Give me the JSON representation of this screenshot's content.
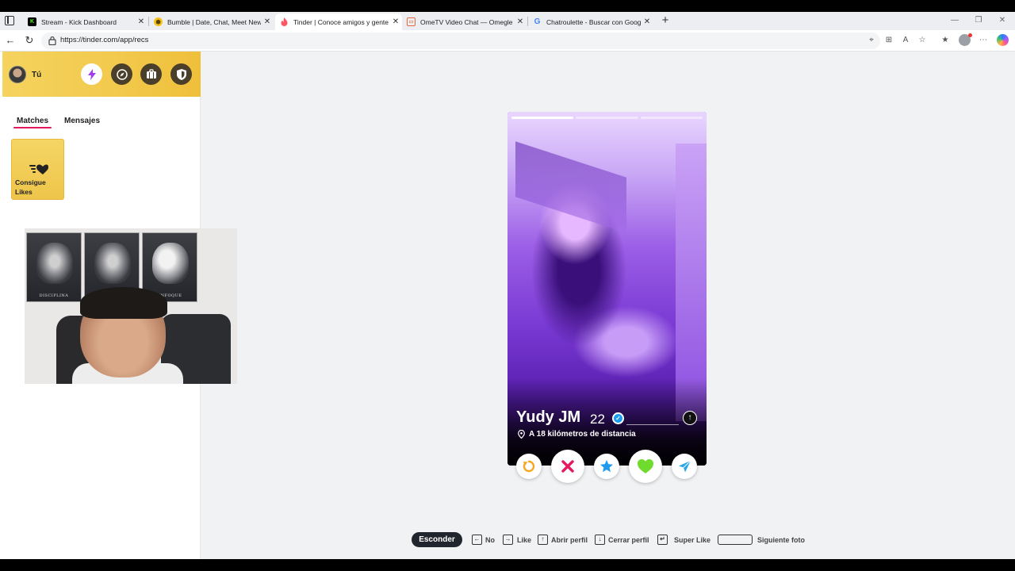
{
  "browser": {
    "tabs": [
      {
        "title": "Stream - Kick Dashboard",
        "icon": "kick-icon"
      },
      {
        "title": "Bumble | Date, Chat, Meet New Pe",
        "icon": "bumble-icon"
      },
      {
        "title": "Tinder | Conoce amigos y gente n",
        "icon": "tinder-icon"
      },
      {
        "title": "OmeTV Video Chat — Omegle Ra",
        "icon": "ometv-icon"
      },
      {
        "title": "Chatroulette - Buscar con Google",
        "icon": "google-icon"
      }
    ],
    "url": "https://tinder.com/app/recs"
  },
  "sidebar": {
    "me_label": "Tú",
    "tabs": [
      {
        "label": "Matches",
        "active": true
      },
      {
        "label": "Mensajes",
        "active": false
      }
    ],
    "likes_card_label": "Consigue Likes",
    "head_buttons": [
      "bolt-icon",
      "explore-icon",
      "briefcase-icon",
      "shield-icon"
    ]
  },
  "webcam": {
    "posters": [
      "DISCIPLINA",
      "",
      "ENFOQUE"
    ]
  },
  "profile": {
    "name": "Yudy JM",
    "age": "22",
    "distance": "A 18 kilómetros de distancia",
    "photo_count": 3,
    "current_photo": 1
  },
  "actions": [
    "rewind-icon",
    "nope-icon",
    "super-like-icon",
    "like-icon",
    "boost-icon"
  ],
  "shortcuts": {
    "hide_label": "Esconder",
    "items": [
      {
        "key": "←",
        "label": "No"
      },
      {
        "key": "→",
        "label": "Like"
      },
      {
        "key": "↑",
        "label": "Abrir perfil"
      },
      {
        "key": "↓",
        "label": "Cerrar perfil"
      },
      {
        "key": "↵",
        "label": "Super Like"
      },
      {
        "key": "",
        "label": "Siguiente foto"
      }
    ]
  },
  "colors": {
    "tinder_accent": "#e5195f",
    "gold": "#f2c94c",
    "like_green": "#6fdc2d",
    "nope_red": "#e8185f",
    "super_blue": "#1e9bf0"
  }
}
